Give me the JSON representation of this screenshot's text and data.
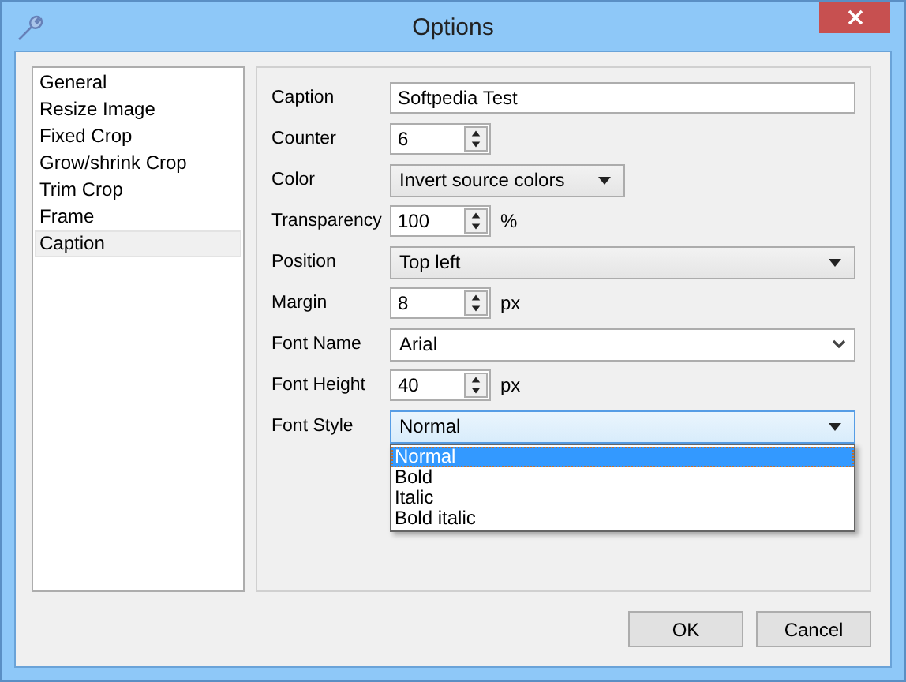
{
  "window": {
    "title": "Options"
  },
  "sidebar": {
    "items": [
      {
        "label": "General",
        "selected": false
      },
      {
        "label": "Resize Image",
        "selected": false
      },
      {
        "label": "Fixed Crop",
        "selected": false
      },
      {
        "label": "Grow/shrink Crop",
        "selected": false
      },
      {
        "label": "Trim Crop",
        "selected": false
      },
      {
        "label": "Frame",
        "selected": false
      },
      {
        "label": "Caption",
        "selected": true
      }
    ]
  },
  "form": {
    "rows": [
      {
        "label": "Caption",
        "kind": "text",
        "value": "Softpedia Test"
      },
      {
        "label": "Counter",
        "kind": "spin",
        "value": "6"
      },
      {
        "label": "Color",
        "kind": "shortcombo",
        "value": "Invert source colors"
      },
      {
        "label": "Transparency",
        "kind": "spin",
        "value": "100",
        "suffix": "%"
      },
      {
        "label": "Position",
        "kind": "combo",
        "value": "Top left"
      },
      {
        "label": "Margin",
        "kind": "spin",
        "value": "8",
        "suffix": "px"
      },
      {
        "label": "Font Name",
        "kind": "editcombo",
        "value": "Arial"
      },
      {
        "label": "Font Height",
        "kind": "spin",
        "value": "40",
        "suffix": "px"
      },
      {
        "label": "Font Style",
        "kind": "opencombo",
        "value": "Normal",
        "options": [
          {
            "label": "Normal",
            "selected": true
          },
          {
            "label": "Bold",
            "selected": false
          },
          {
            "label": "Italic",
            "selected": false
          },
          {
            "label": "Bold italic",
            "selected": false
          }
        ]
      }
    ]
  },
  "buttons": [
    "OK",
    "Cancel"
  ]
}
